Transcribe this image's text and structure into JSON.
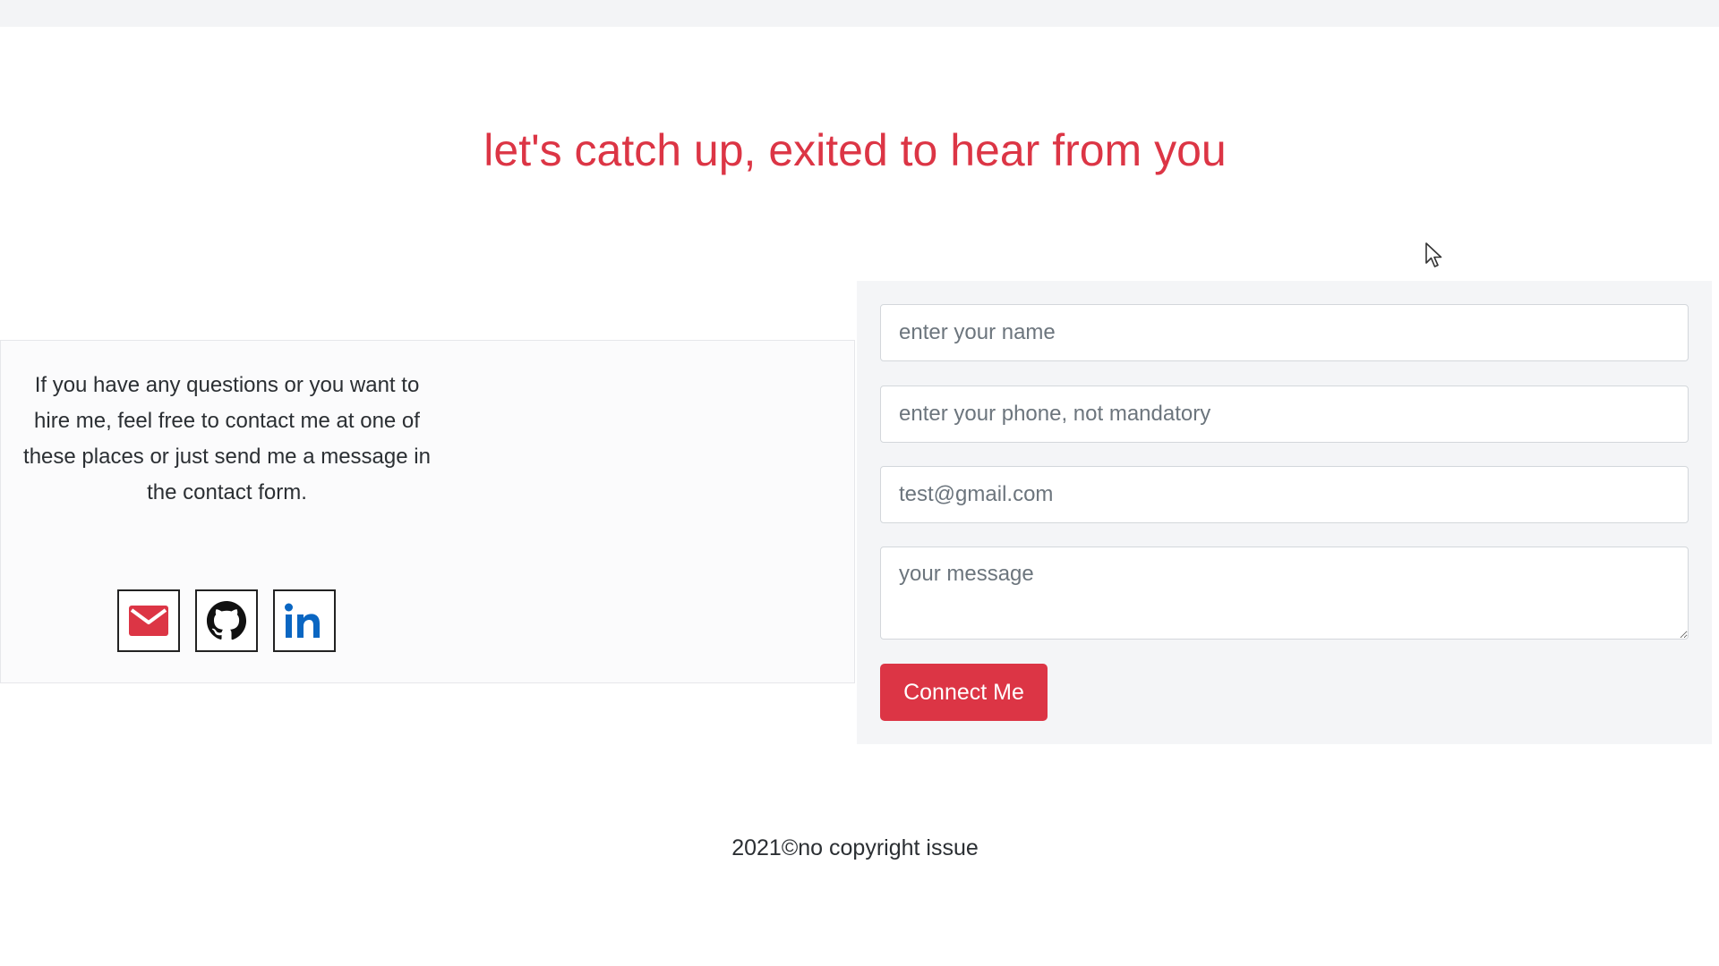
{
  "header": {
    "headline": "let's catch up, exited to hear from you"
  },
  "contact_info": {
    "text": "If you have any questions or you want to hire me, feel free to contact me at one of these places or just send me a message in the contact form.",
    "social_links": [
      {
        "name": "email",
        "icon": "envelope-icon",
        "color": "#dc3545"
      },
      {
        "name": "github",
        "icon": "github-icon",
        "color": "#111111"
      },
      {
        "name": "linkedin",
        "icon": "linkedin-icon",
        "color": "#0a66c2"
      }
    ]
  },
  "form": {
    "name_placeholder": "enter your name",
    "phone_placeholder": "enter your phone, not mandatory",
    "email_value": "test@gmail.com",
    "message_placeholder": "your message",
    "submit_label": "Connect Me"
  },
  "footer": {
    "text": "2021©no copyright issue"
  },
  "colors": {
    "accent": "#dc3545",
    "panel_bg": "#f4f5f7",
    "card_bg": "#fbfbfc"
  }
}
